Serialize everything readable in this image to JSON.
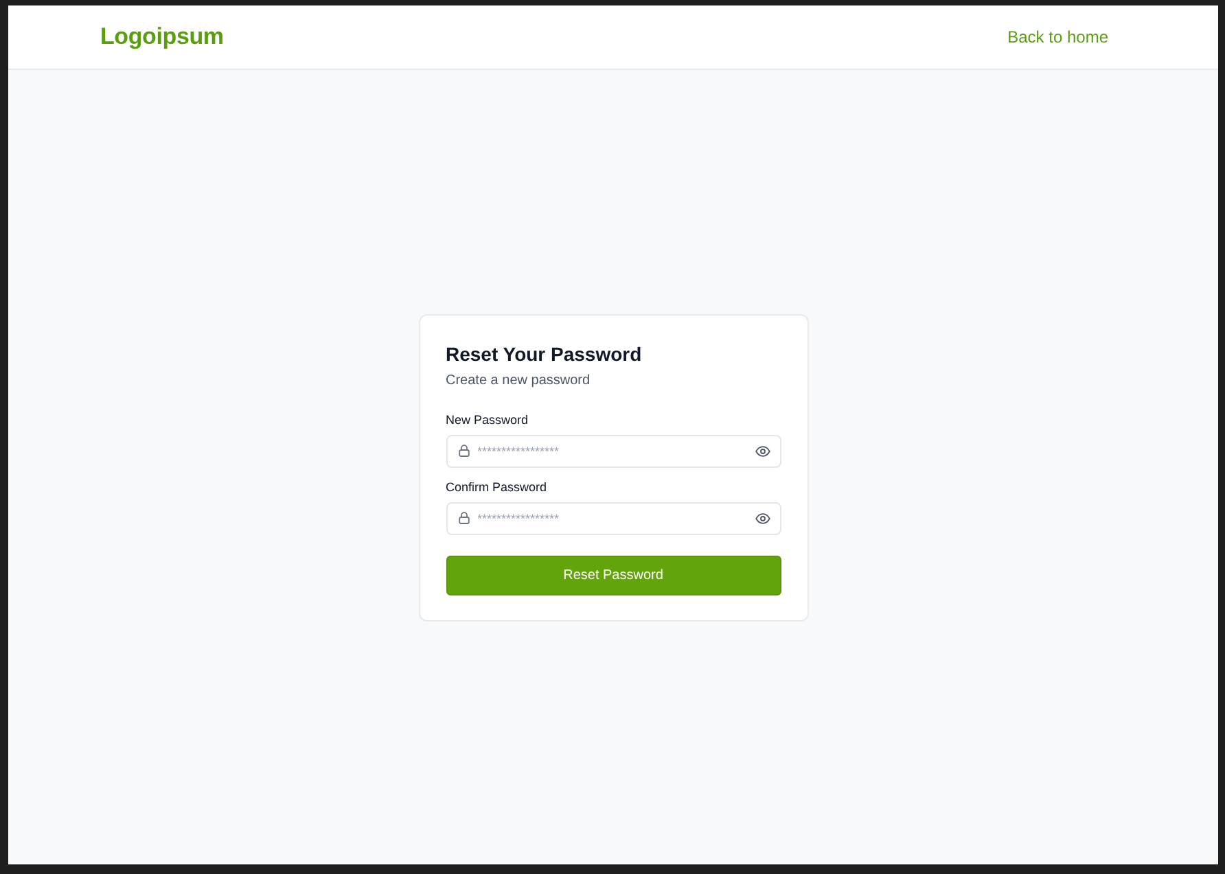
{
  "header": {
    "logo": "Logoipsum",
    "link": "Back to home"
  },
  "card": {
    "title": "Reset Your Password",
    "subtitle": "Create a new password",
    "fields": [
      {
        "label": "New Password",
        "placeholder": "*****************"
      },
      {
        "label": "Confirm Password",
        "placeholder": "*****************"
      }
    ],
    "button": "Reset Password"
  }
}
